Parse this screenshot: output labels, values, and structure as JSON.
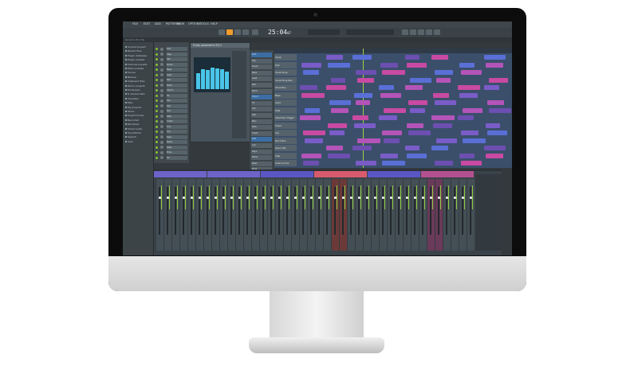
{
  "app": {
    "menu": [
      "FILE",
      "EDIT",
      "ADD",
      "PATTERNS",
      "VIEW",
      "OPTIONS",
      "TOOLS",
      "HELP"
    ],
    "clock": "25:04",
    "clock_small": "07",
    "hint": "Rename this file"
  },
  "browser": {
    "items": [
      "Current project",
      "Recent files",
      "Plugin database",
      "Plugin presets",
      "Channel presets",
      "Mixer presets",
      "Scores",
      "Backup",
      "Clipboard files",
      "Demo projects",
      "Envelopes",
      "IL shared data",
      "Impulses",
      "Misc",
      "My projects",
      "Packs",
      "Project bones",
      "Recorded",
      "Rendered",
      "Sliced audio",
      "Soundfonts",
      "Speech",
      "User"
    ]
  },
  "channel_rack": {
    "title": "Channel rack",
    "channels": [
      "Kick",
      "Clap",
      "Hat",
      "Snare",
      "Bass",
      "Lead",
      "Pad",
      "Pluck",
      "Chord",
      "FX",
      "Vox",
      "Sub",
      "Perc",
      "Ride",
      "Crash",
      "Tom",
      "Arp",
      "Keys",
      "Noise",
      "Riser",
      "Drop",
      "Fill"
    ]
  },
  "plugin": {
    "title": "Fruity parametric EQ 2",
    "bands": [
      0.55,
      0.7,
      0.68,
      0.75,
      0.72,
      0.7,
      0.6
    ]
  },
  "selector": {
    "items": [
      "Kick",
      "Hat",
      "Snare",
      "Bass",
      "Lead",
      "Pad",
      "Pluck",
      "Chord",
      "FX",
      "Vox",
      "Sub",
      "Perc",
      "Ride",
      "Crash",
      "Tom",
      "Arp",
      "Keys",
      "Noise",
      "Riser",
      "Drop"
    ]
  },
  "playlist": {
    "tracks": [
      "Vocal",
      "Kick",
      "Vocal Chop",
      "Vocal Chop Rev",
      "Vocal Rev",
      "Bass",
      "Lead",
      "Hats",
      "Sidechain Trigger",
      "Snare",
      "Arp",
      "Pluck Rev",
      "Open Hat",
      "Clap",
      "Channel Vox"
    ]
  },
  "mixer": {
    "strip_count": 40
  }
}
